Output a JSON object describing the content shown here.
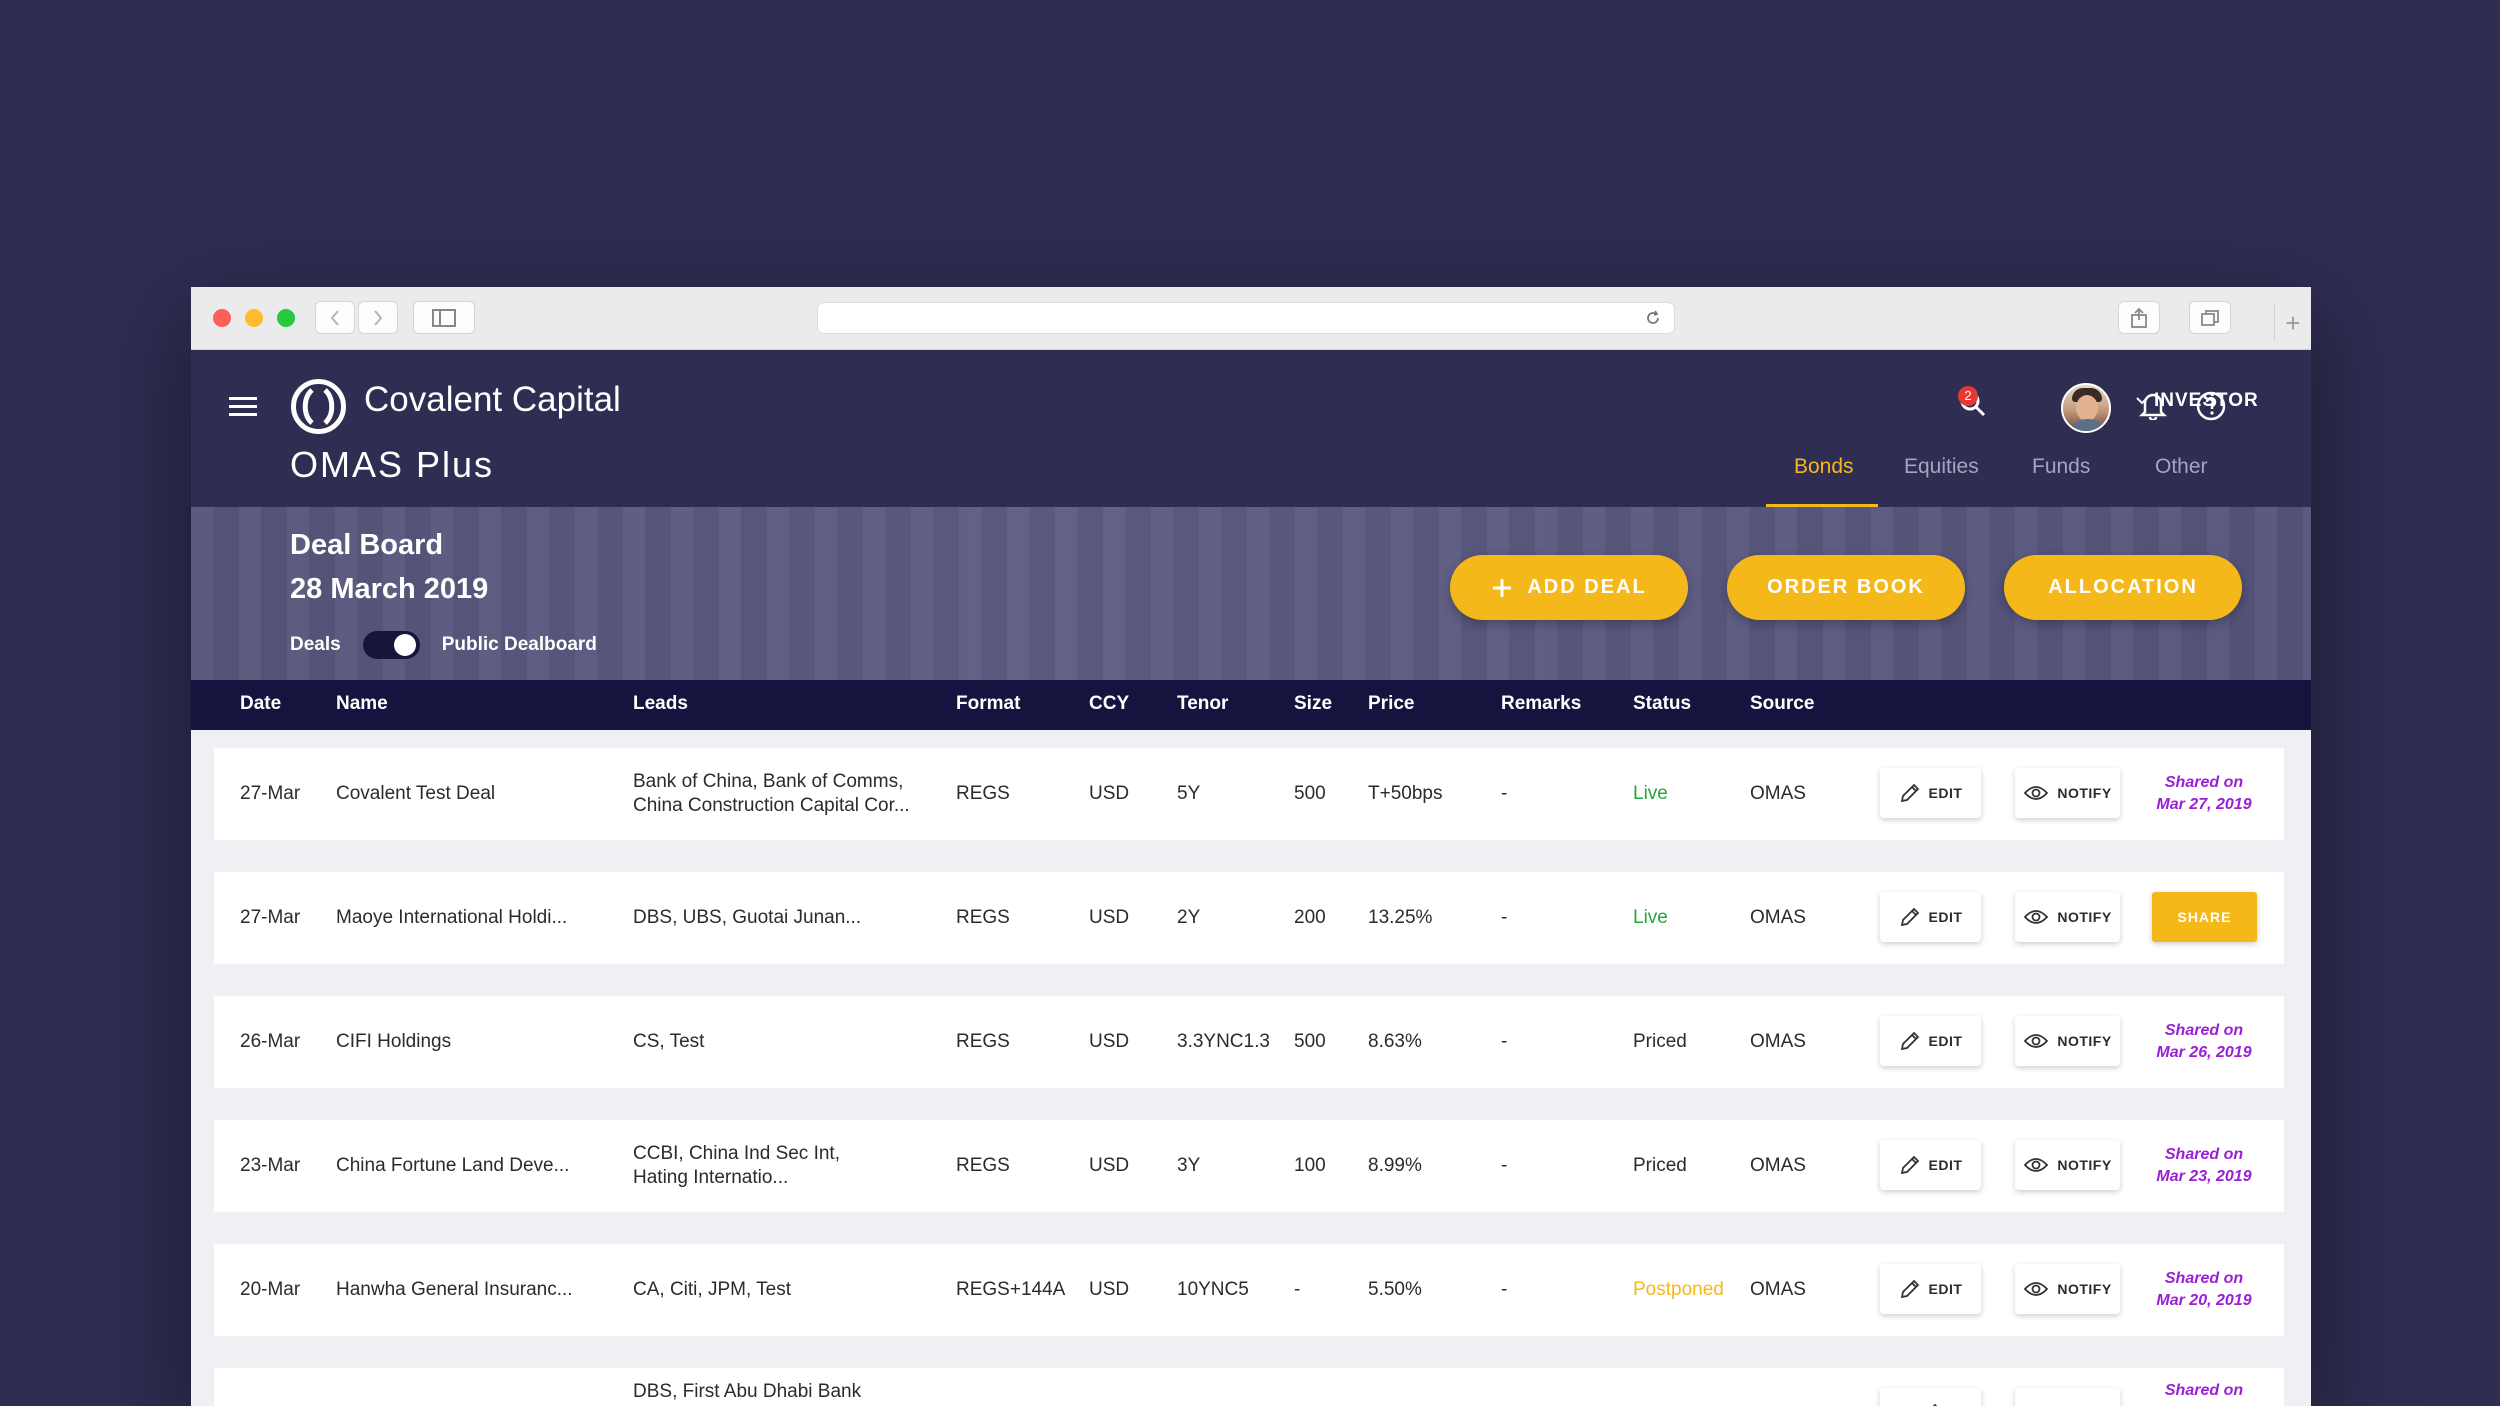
{
  "browser": {
    "nav_back_icon": "chevron-left-icon",
    "nav_forward_icon": "chevron-right-icon",
    "sidebar_icon": "sidebar-icon",
    "reload_icon": "reload-icon",
    "share_icon": "share-icon",
    "tabs_icon": "tabs-icon",
    "new_tab_label": "+"
  },
  "header": {
    "brand_name": "Covalent Capital",
    "app_name": "OMAS Plus",
    "notification_count": "2",
    "role_label": "INVESTOR",
    "tabs": [
      {
        "label": "Bonds",
        "active": true
      },
      {
        "label": "Equities",
        "active": false
      },
      {
        "label": "Funds",
        "active": false
      },
      {
        "label": "Other",
        "active": false
      }
    ]
  },
  "board": {
    "title": "Deal Board",
    "date": "28 March 2019",
    "toggle_left_label": "Deals",
    "toggle_right_label": "Public Dealboard",
    "buttons": {
      "add_deal": "ADD DEAL",
      "order_book": "ORDER BOOK",
      "allocation": "ALLOCATION"
    }
  },
  "table": {
    "columns": [
      "Date",
      "Name",
      "Leads",
      "Format",
      "CCY",
      "Tenor",
      "Size",
      "Price",
      "Remarks",
      "Status",
      "Source"
    ],
    "edit_label": "EDIT",
    "notify_label": "NOTIFY",
    "share_label": "SHARE",
    "rows": [
      {
        "date": "27-Mar",
        "name": "Covalent Test Deal",
        "leads1": "Bank of China, Bank of Comms,",
        "leads2": "China Construction Capital Cor...",
        "format": "REGS",
        "ccy": "USD",
        "tenor": "5Y",
        "size": "500",
        "price": "T+50bps",
        "remarks": "-",
        "status": "Live",
        "source": "OMAS",
        "shared1": "Shared on",
        "shared2": "Mar 27, 2019"
      },
      {
        "date": "27-Mar",
        "name": "Maoye International Holdi...",
        "leads1": "DBS, UBS, Guotai Junan...",
        "leads2": "",
        "format": "REGS",
        "ccy": "USD",
        "tenor": "2Y",
        "size": "200",
        "price": "13.25%",
        "remarks": "-",
        "status": "Live",
        "source": "OMAS",
        "shared1": "",
        "shared2": ""
      },
      {
        "date": "26-Mar",
        "name": "CIFI Holdings",
        "leads1": "CS, Test",
        "leads2": "",
        "format": "REGS",
        "ccy": "USD",
        "tenor": "3.3YNC1.3",
        "size": "500",
        "price": "8.63%",
        "remarks": "-",
        "status": "Priced",
        "source": "OMAS",
        "shared1": "Shared on",
        "shared2": "Mar 26, 2019"
      },
      {
        "date": "23-Mar",
        "name": "China Fortune Land Deve...",
        "leads1": "CCBI, China Ind Sec Int,",
        "leads2": "Hating Internatio...",
        "format": "REGS",
        "ccy": "USD",
        "tenor": "3Y",
        "size": "100",
        "price": "8.99%",
        "remarks": "-",
        "status": "Priced",
        "source": "OMAS",
        "shared1": "Shared on",
        "shared2": "Mar 23, 2019"
      },
      {
        "date": "20-Mar",
        "name": "Hanwha General Insuranc...",
        "leads1": "CA, Citi, JPM, Test",
        "leads2": "",
        "format": "REGS+144A",
        "ccy": "USD",
        "tenor": "10YNC5",
        "size": "-",
        "price": "5.50%",
        "remarks": "-",
        "status": "Postponed",
        "source": "OMAS",
        "shared1": "Shared on",
        "shared2": "Mar 20, 2019"
      },
      {
        "date": "",
        "name": "",
        "leads1": "DBS, First Abu Dhabi Bank",
        "leads2": "",
        "format": "",
        "ccy": "",
        "tenor": "",
        "size": "",
        "price": "",
        "remarks": "",
        "status": "",
        "source": "",
        "shared1": "Shared on",
        "shared2": ""
      }
    ]
  },
  "colors": {
    "header_bg": "#2f2d52",
    "table_header_bg": "#16143e",
    "accent": "#f5b81a",
    "live": "#27a53a",
    "postponed": "#f5b81a",
    "shared": "#9b1fd6"
  }
}
